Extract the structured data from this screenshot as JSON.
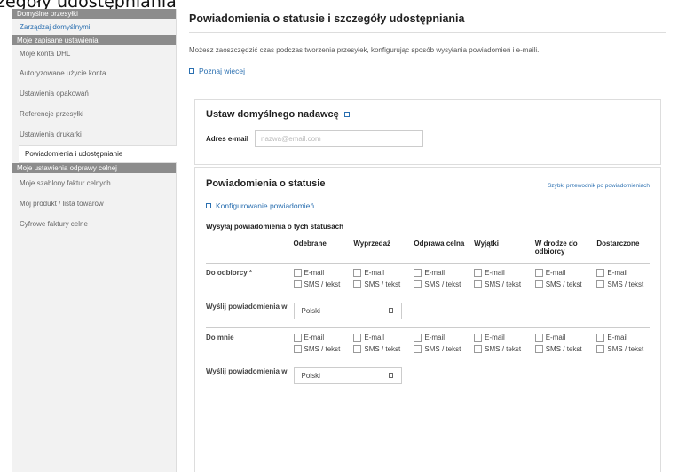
{
  "page_top_title": "zegóły udostępniania",
  "sidebar": {
    "sections": [
      {
        "header": "Domyślne przesyłki",
        "items": [
          {
            "label": "Zarządzaj domyślnymi",
            "link": true
          }
        ]
      },
      {
        "header": "Moje zapisane ustawienia",
        "items": [
          {
            "label": "Moje konta DHL"
          },
          {
            "label": "Autoryzowane użycie konta"
          },
          {
            "label": "Ustawienia opakowań"
          },
          {
            "label": "Referencje przesyłki"
          },
          {
            "label": "Ustawienia drukarki"
          },
          {
            "label": "Powiadomienia i udostępnianie",
            "active": true
          }
        ]
      },
      {
        "header": "Moje ustawienia odprawy celnej",
        "items": [
          {
            "label": "Moje szablony faktur celnych"
          },
          {
            "label": "Mój produkt / lista towarów"
          },
          {
            "label": "Cyfrowe faktury celne"
          }
        ]
      }
    ]
  },
  "main": {
    "title": "Powiadomienia o statusie i szczegóły udostępniania",
    "intro": "Możesz zaoszczędzić czas podczas tworzenia przesyłek, konfigurując sposób wysyłania powiadomień i e-maili.",
    "learn_more": "Poznaj więcej",
    "sender": {
      "title": "Ustaw domyślnego nadawcę",
      "email_label": "Adres e-mail",
      "email_placeholder": "nazwa@email.com"
    },
    "notifications": {
      "title": "Powiadomienia o statusie",
      "guide_link": "Szybki przewodnik po powiadomieniach",
      "configure_link": "Konfigurowanie powiadomień",
      "send_title": "Wysyłaj powiadomienia o tych statusach",
      "columns": [
        "Odebrane",
        "Wyprzedaż",
        "Odprawa celna",
        "Wyjątki",
        "W drodze do odbiorcy",
        "Dostarczone"
      ],
      "option_email": "E-mail",
      "option_sms": "SMS / tekst",
      "recipient_label": "Do odbiorcy *",
      "me_label": "Do mnie",
      "lang_label": "Wyślij powiadomienia w",
      "lang_value_1": "Polski",
      "lang_value_2": "Polski"
    }
  }
}
